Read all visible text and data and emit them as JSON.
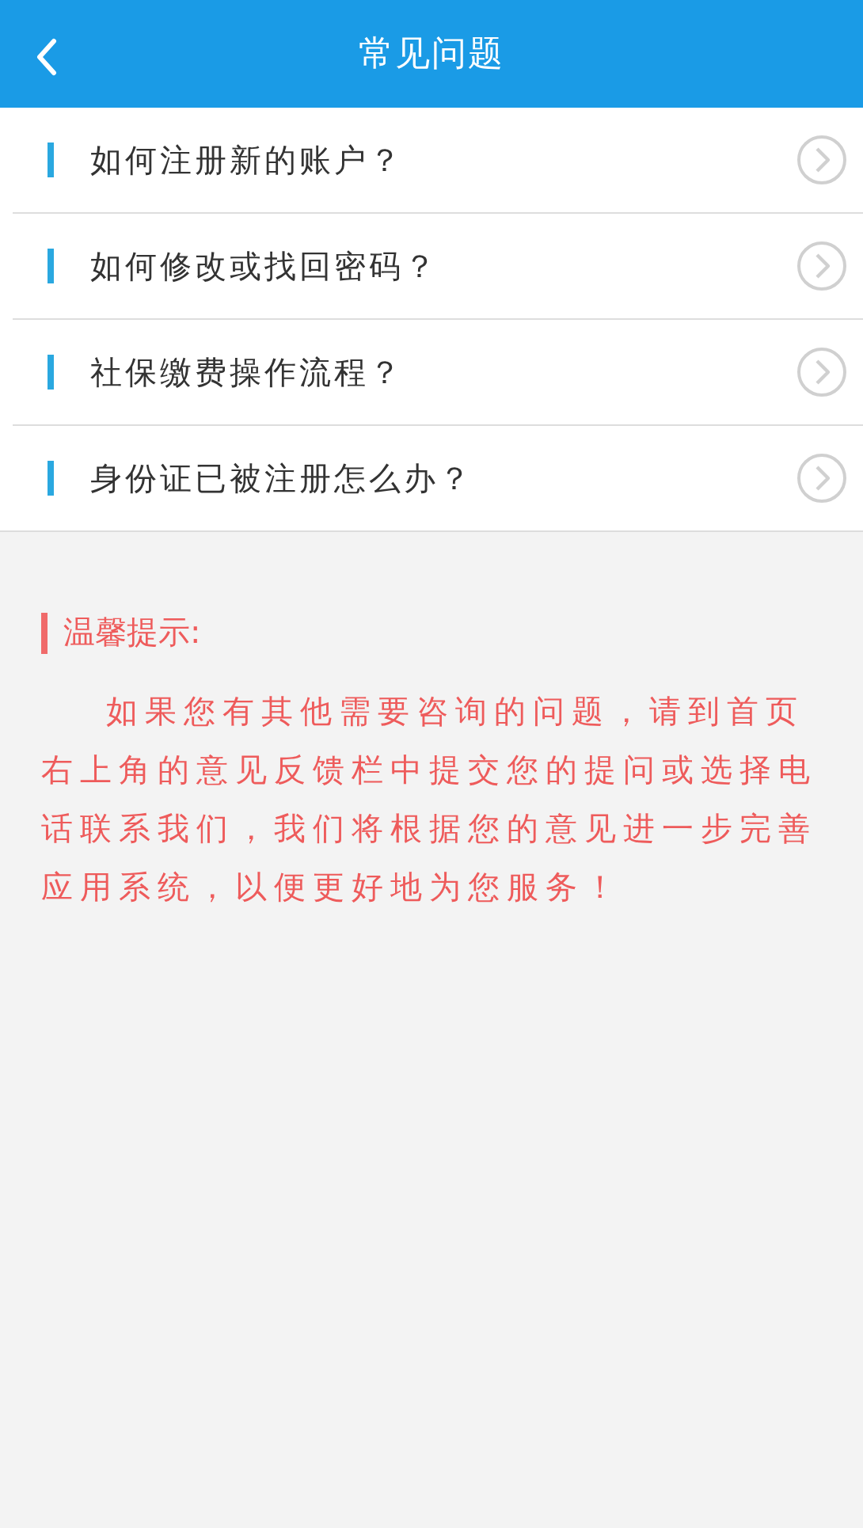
{
  "header": {
    "title": "常见问题"
  },
  "questions": [
    {
      "text": "如何注册新的账户？"
    },
    {
      "text": "如何修改或找回密码？"
    },
    {
      "text": "社保缴费操作流程？"
    },
    {
      "text": "身份证已被注册怎么办？"
    }
  ],
  "tip": {
    "title": "温馨提示:",
    "body": "如果您有其他需要咨询的问题，请到首页右上角的意见反馈栏中提交您的提问或选择电话联系我们，我们将根据您的意见进一步完善应用系统，以便更好地为您服务！"
  }
}
